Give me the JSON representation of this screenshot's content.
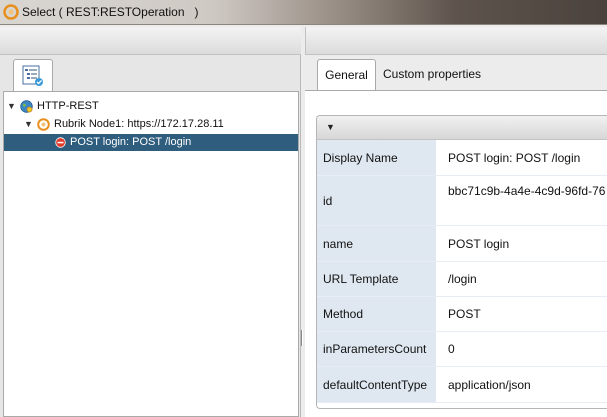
{
  "window": {
    "title": "Select ( REST:RESTOperation   )"
  },
  "left_panel": {
    "tab_icon": "tree-view-icon",
    "tree": [
      {
        "label": "HTTP-REST",
        "icon": "globe-icon",
        "expanded": true
      },
      {
        "label": "Rubrik Node1: https://172.17.28.11",
        "icon": "rest-host-icon",
        "expanded": true
      },
      {
        "label": "POST login: POST /login",
        "icon": "operation-icon",
        "selected": true
      }
    ]
  },
  "right_panel": {
    "tabs": [
      {
        "label": "General",
        "active": true
      },
      {
        "label": "Custom properties",
        "active": false
      }
    ],
    "properties": [
      {
        "key": "Display Name",
        "value": "POST login: POST /login"
      },
      {
        "key": "id",
        "value": "bbc71c9b-4a4e-4c9d-96fd-76"
      },
      {
        "key": "name",
        "value": "POST login"
      },
      {
        "key": "URL Template",
        "value": "/login"
      },
      {
        "key": "Method",
        "value": "POST"
      },
      {
        "key": "inParametersCount",
        "value": "0"
      },
      {
        "key": "defaultContentType",
        "value": "application/json"
      }
    ]
  },
  "colors": {
    "selection": "#2f5d7e",
    "property_key_bg": "#dfe8f0",
    "app_icon_orange": "#e8901e"
  }
}
